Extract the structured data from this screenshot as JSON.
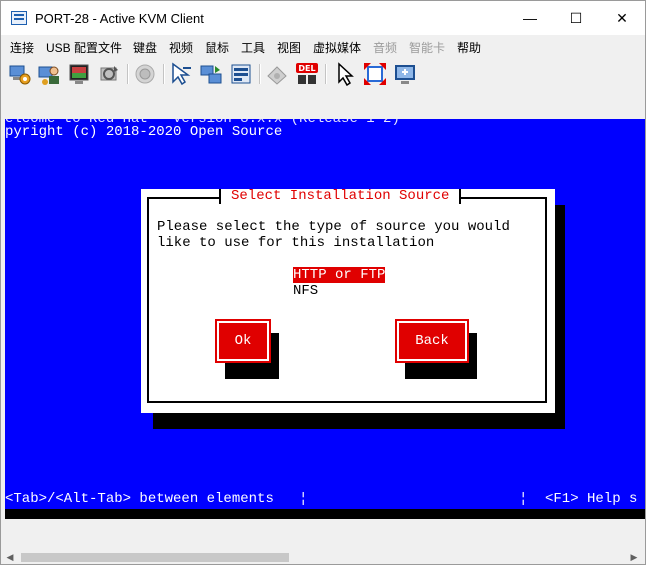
{
  "window": {
    "title": "PORT-28 - Active KVM Client",
    "minimize": "—",
    "maximize": "☐",
    "close": "✕"
  },
  "menubar": {
    "items": [
      {
        "label": "连接"
      },
      {
        "label": "USB 配置文件"
      },
      {
        "label": "键盘"
      },
      {
        "label": "视频"
      },
      {
        "label": "鼠标"
      },
      {
        "label": "工具"
      },
      {
        "label": "视图"
      },
      {
        "label": "虚拟媒体"
      },
      {
        "label": "音频",
        "disabled": true
      },
      {
        "label": "智能卡",
        "disabled": true
      },
      {
        "label": "帮助"
      }
    ]
  },
  "toolbar": {
    "icons": [
      "connection-properties-icon",
      "user-list-icon",
      "video-settings-icon",
      "refresh-video-icon",
      "capture-screenshot-icon",
      "single-cursor-icon",
      "keyboard-macros-icon",
      "virtual-media-icon",
      "smart-card-icon",
      "ctrl-alt-del-icon",
      "mouse-pointer-icon",
      "full-screen-icon",
      "scale-video-icon"
    ]
  },
  "console": {
    "clipped_line": "elcome to Red Hat - Version 8.x.x (Release 1-2)",
    "copyright": "pyright (c) 2018-2020 Open Source",
    "dialog": {
      "title": "Select Installation Source",
      "prompt_line1": "Please select the type of source you would",
      "prompt_line2": "like to use for this installation",
      "options": [
        {
          "label": "HTTP or FTP",
          "selected": true
        },
        {
          "label": "NFS",
          "selected": false
        }
      ],
      "ok_label": "Ok",
      "back_label": "Back"
    },
    "status_left": "<Tab>/<Alt-Tab> between elements   ¦",
    "status_divider": "¦",
    "status_right": "<F1> Help s"
  },
  "colors": {
    "console_bg": "#0000ff",
    "dialog_accent": "#e00000"
  }
}
